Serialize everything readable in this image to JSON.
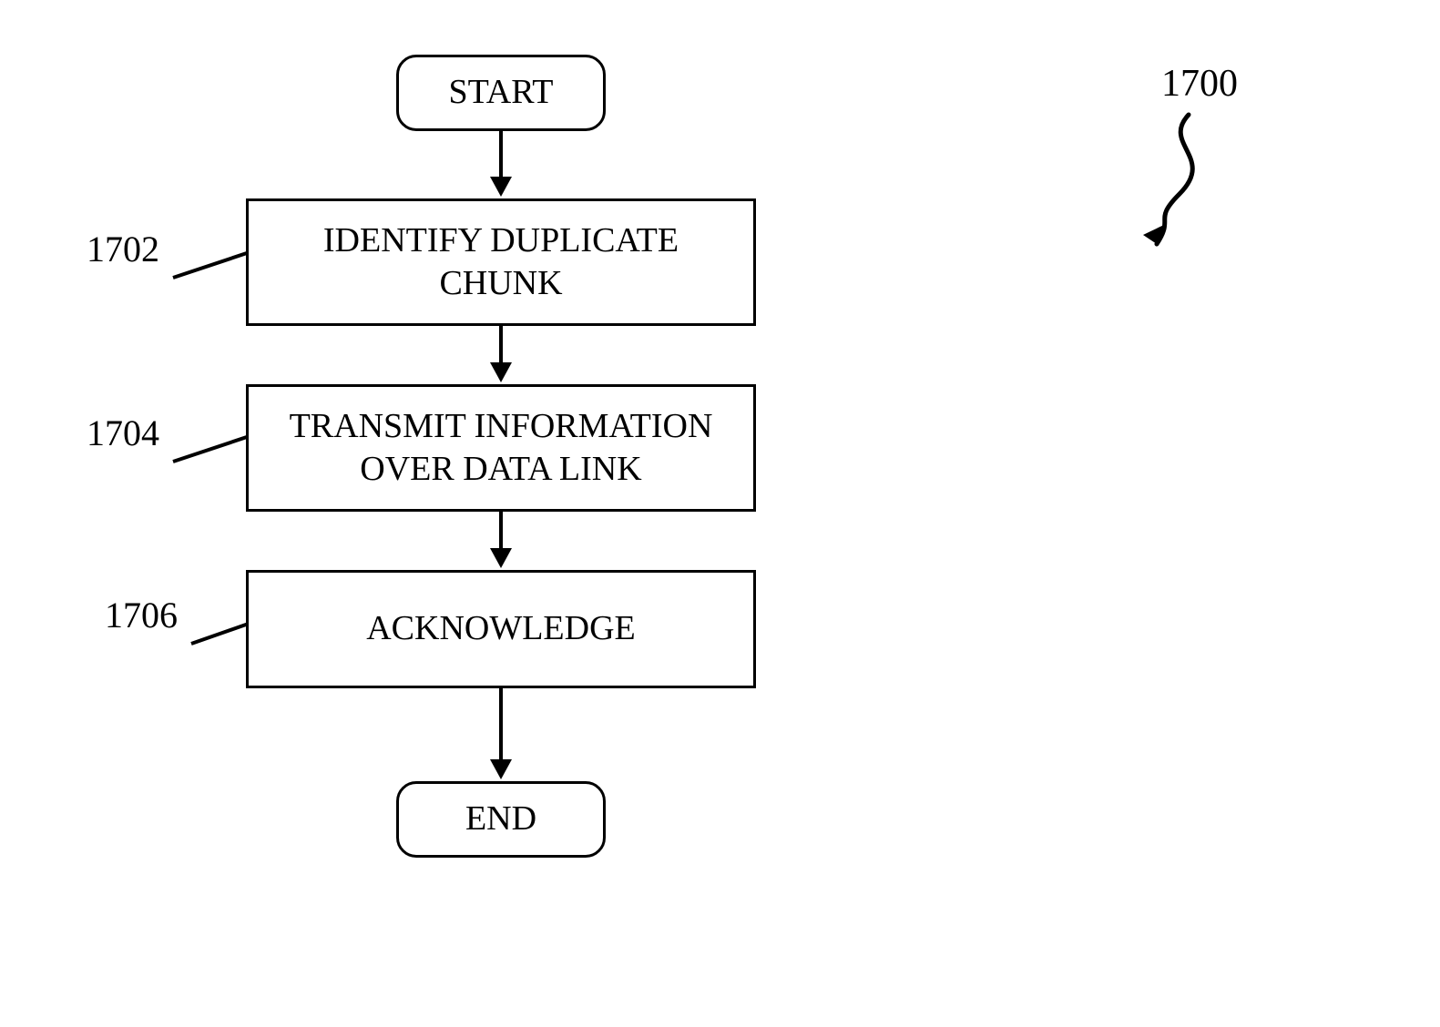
{
  "figure": {
    "number": "1700",
    "refs": {
      "r1": "1702",
      "r2": "1704",
      "r3": "1706"
    },
    "nodes": {
      "start": "START",
      "step1": "IDENTIFY DUPLICATE CHUNK",
      "step2": "TRANSMIT INFORMATION OVER DATA LINK",
      "step3": "ACKNOWLEDGE",
      "end": "END"
    }
  }
}
